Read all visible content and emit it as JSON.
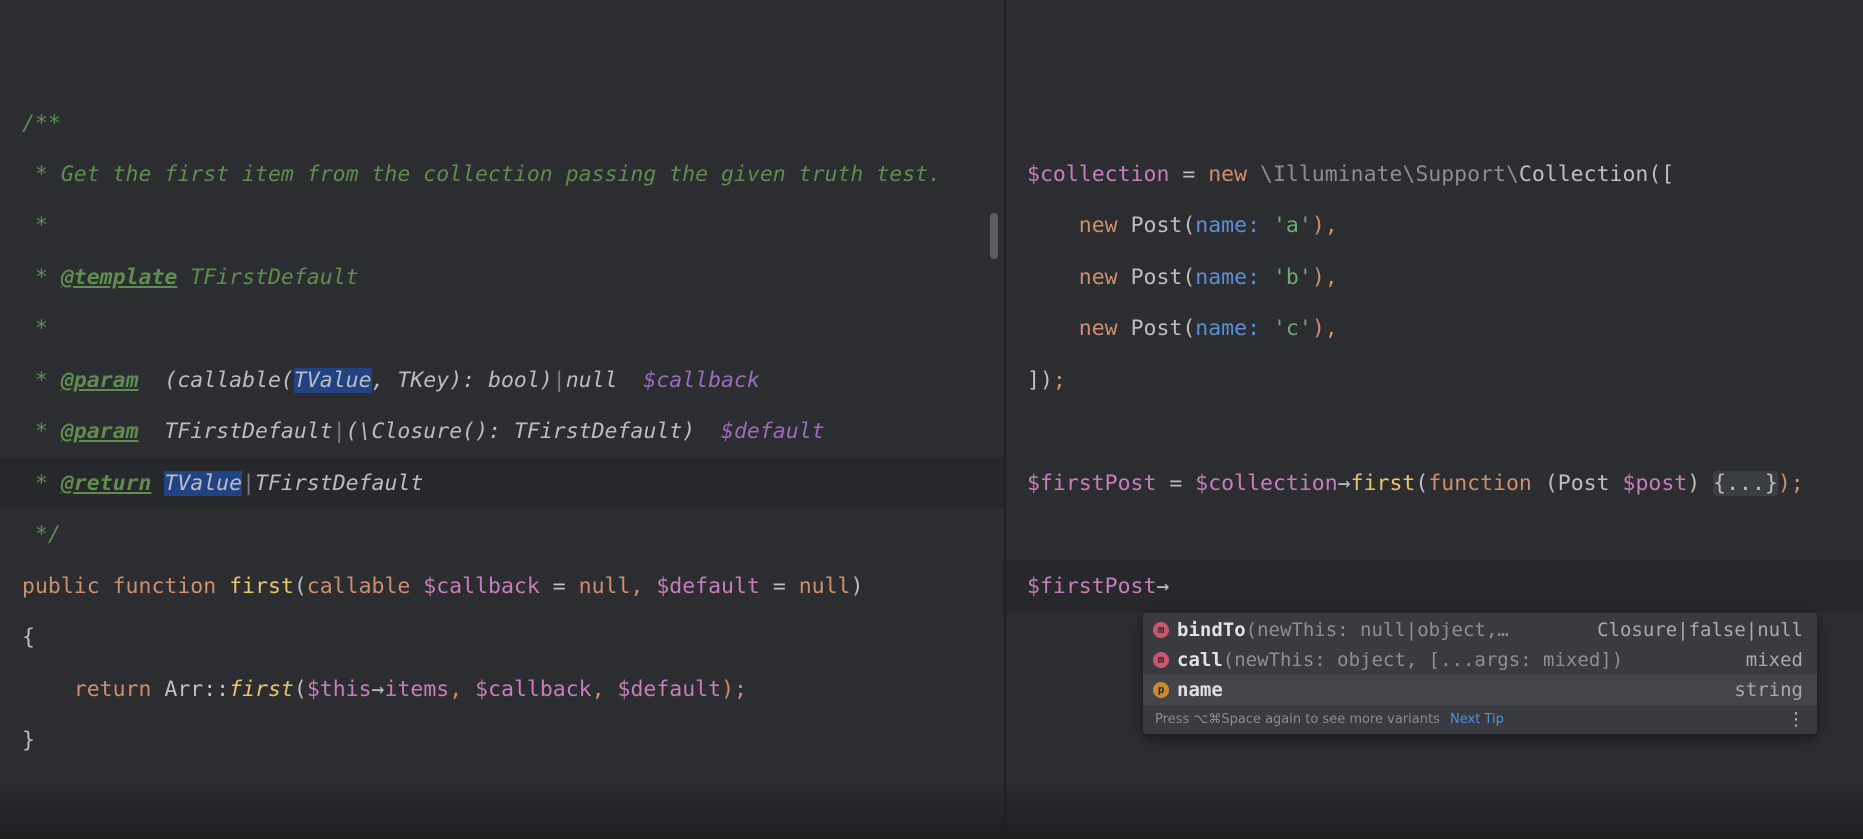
{
  "left_editor": {
    "doc_open": "/**",
    "doc_line1": " * Get the first item from the collection passing the given truth test.",
    "doc_star": " *",
    "doc_star_prefix": " * ",
    "template_tag": "@template",
    "template_type": " TFirstDefault",
    "param_tag": "@param",
    "param1_pre": "  (callable(",
    "param1_hl": "TValue",
    "param1_mid": ", TKey): bool)",
    "bar": "|",
    "null_word": "null",
    "param1_var": "  $callback",
    "param2_type_a": "  TFirstDefault",
    "param2_type_b": "(\\Closure(): TFirstDefault)",
    "param2_var": "  $default",
    "return_tag": "@return",
    "space": " ",
    "return_hl": "TValue",
    "return_type_b": "TFirstDefault",
    "doc_close": " */",
    "kw_public": "public ",
    "kw_function": "function ",
    "fn_first": "first",
    "paren_open": "(",
    "kw_callable": "callable ",
    "var_callback": "$callback",
    "eq": " = ",
    "kw_null": "null",
    "comma": ", ",
    "var_default": "$default",
    "paren_close": ")",
    "brace_open": "{",
    "indent": "    ",
    "kw_return": "return ",
    "cls_arr": "Arr",
    "dcolon": "::",
    "var_this": "$this",
    "arrow": "→",
    "prop_items": "items",
    "end_stmt": ");",
    "brace_close": "}"
  },
  "right_editor": {
    "var_collection": "$collection",
    "eq": " = ",
    "kw_new": "new ",
    "ns_path": "\\Illuminate\\Support\\",
    "cls_collection": "Collection",
    "open_bracket": "([",
    "indent": "    ",
    "cls_post": "Post",
    "paren_open": "(",
    "param_name": "name: ",
    "str_a": "'a'",
    "str_b": "'b'",
    "str_c": "'c'",
    "item_end": "),",
    "close_bracket": "])",
    "semicolon": ";",
    "var_firstpost": "$firstPost",
    "arrow": "→",
    "fn_first": "first",
    "kw_function": "function",
    "sig_open": " (",
    "type_post": "Post",
    "var_post": " $post",
    "sig_close": ") ",
    "fold_body": "{...}",
    "stmt_end": ");"
  },
  "completion": {
    "items": [
      {
        "icon": "m",
        "name": "bindTo",
        "signature": "(newThis: null|object,…",
        "type": "Closure|false|null"
      },
      {
        "icon": "m",
        "name": "call",
        "signature": "(newThis: object, [...args: mixed])",
        "type": "mixed"
      },
      {
        "icon": "p",
        "name": "name",
        "signature": "",
        "type": "string"
      }
    ],
    "hint": "Press ⌥⌘Space again to see more variants",
    "next_tip": "Next Tip",
    "more": "⋮"
  },
  "colors": {
    "background": "#2b2d30",
    "keyword": "#cf8e6d",
    "function": "#e8c46b",
    "variable": "#c77dbb",
    "doc_comment": "#5f8c4f",
    "string": "#6aab73",
    "named_param": "#5a8fd6",
    "selection": "#214283"
  }
}
